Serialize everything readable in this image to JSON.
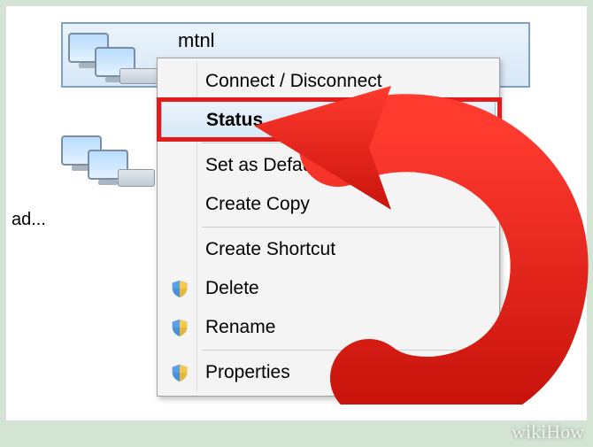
{
  "connection": {
    "name": "mtnl"
  },
  "truncated_label": "ad...",
  "menu": {
    "items": [
      {
        "label": "Connect / Disconnect",
        "bold": false,
        "shield": false,
        "hover": false
      },
      {
        "label": "Status",
        "bold": true,
        "shield": false,
        "hover": true
      },
      {
        "label": "Set as Default",
        "bold": false,
        "shield": false,
        "hover": false,
        "sep_before": true
      },
      {
        "label": "Create Copy",
        "bold": false,
        "shield": false,
        "hover": false
      },
      {
        "label": "Create Shortcut",
        "bold": false,
        "shield": false,
        "hover": false,
        "sep_before": true
      },
      {
        "label": "Delete",
        "bold": false,
        "shield": true,
        "hover": false
      },
      {
        "label": "Rename",
        "bold": false,
        "shield": true,
        "hover": false
      },
      {
        "label": "Properties",
        "bold": false,
        "shield": true,
        "hover": false,
        "sep_before": true
      }
    ]
  },
  "watermark": "wikiHow",
  "highlight_color": "#e21b1b"
}
